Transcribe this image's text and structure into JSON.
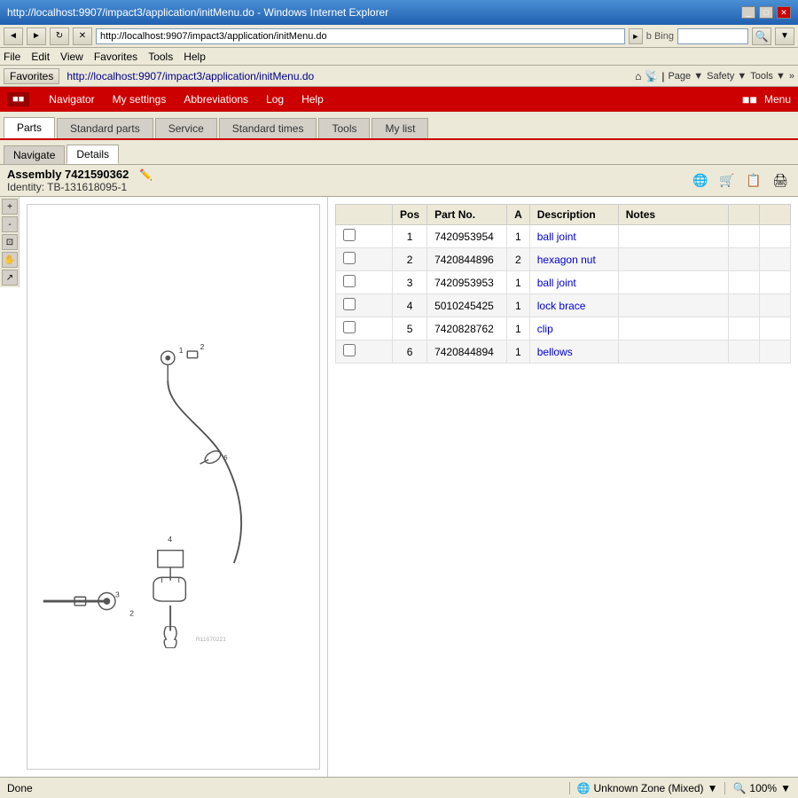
{
  "browser": {
    "title": "http://localhost:9907/impact3/application/initMenu.do - Windows Internet Explorer",
    "address": "http://localhost:9907/impact3/application/initMenu.do",
    "search_placeholder": "Bing",
    "window_controls": [
      "_",
      "□",
      "✕"
    ]
  },
  "menu_bar": {
    "items": [
      "File",
      "Edit",
      "View",
      "Favorites",
      "Tools",
      "Help"
    ]
  },
  "favorites_bar": {
    "favorites_label": "Favorites",
    "fav_link": "http://localhost:9907/impact3/application/initMenu.do",
    "right_buttons": [
      "Page ▼",
      "Safety ▼",
      "Tools ▼",
      "»"
    ]
  },
  "app_nav": {
    "logo": "■■",
    "items": [
      "Navigator",
      "My settings",
      "Abbreviations",
      "Log",
      "Help"
    ],
    "right_text": "Menu"
  },
  "tabs": {
    "items": [
      "Parts",
      "Standard parts",
      "Service",
      "Standard times",
      "Tools",
      "My list"
    ],
    "active": "Parts"
  },
  "sub_tabs": {
    "items": [
      "Navigate",
      "Details"
    ],
    "active": "Details"
  },
  "assembly": {
    "title": "Assembly 7421590362",
    "identity": "Identity: TB-131618095-1"
  },
  "parts_table": {
    "headers": [
      "",
      "Pos",
      "Part No.",
      "A",
      "Description",
      "Notes",
      "",
      ""
    ],
    "rows": [
      {
        "pos": "1",
        "part_no": "7420953954",
        "qty": "1",
        "description": "ball joint",
        "notes": ""
      },
      {
        "pos": "2",
        "part_no": "7420844896",
        "qty": "2",
        "description": "hexagon nut",
        "notes": ""
      },
      {
        "pos": "3",
        "part_no": "7420953953",
        "qty": "1",
        "description": "ball joint",
        "notes": ""
      },
      {
        "pos": "4",
        "part_no": "5010245425",
        "qty": "1",
        "description": "lock brace",
        "notes": ""
      },
      {
        "pos": "5",
        "part_no": "7420828762",
        "qty": "1",
        "description": "clip",
        "notes": ""
      },
      {
        "pos": "6",
        "part_no": "7420844894",
        "qty": "1",
        "description": "bellows",
        "notes": ""
      }
    ]
  },
  "diagram": {
    "watermark": "R11070221"
  },
  "status_bar": {
    "left": "Done",
    "zone": "Unknown Zone (Mixed)",
    "zoom": "100%"
  },
  "icons": {
    "back": "◄",
    "forward": "►",
    "refresh": "↻",
    "stop": "✕",
    "home": "⌂",
    "search": "🔍",
    "globe": "🌐",
    "cart": "🛒",
    "copy": "📋",
    "print": "🖨",
    "zoom_in": "🔍",
    "zoom_out": "🔎",
    "fit": "⊡",
    "pan": "✋"
  }
}
